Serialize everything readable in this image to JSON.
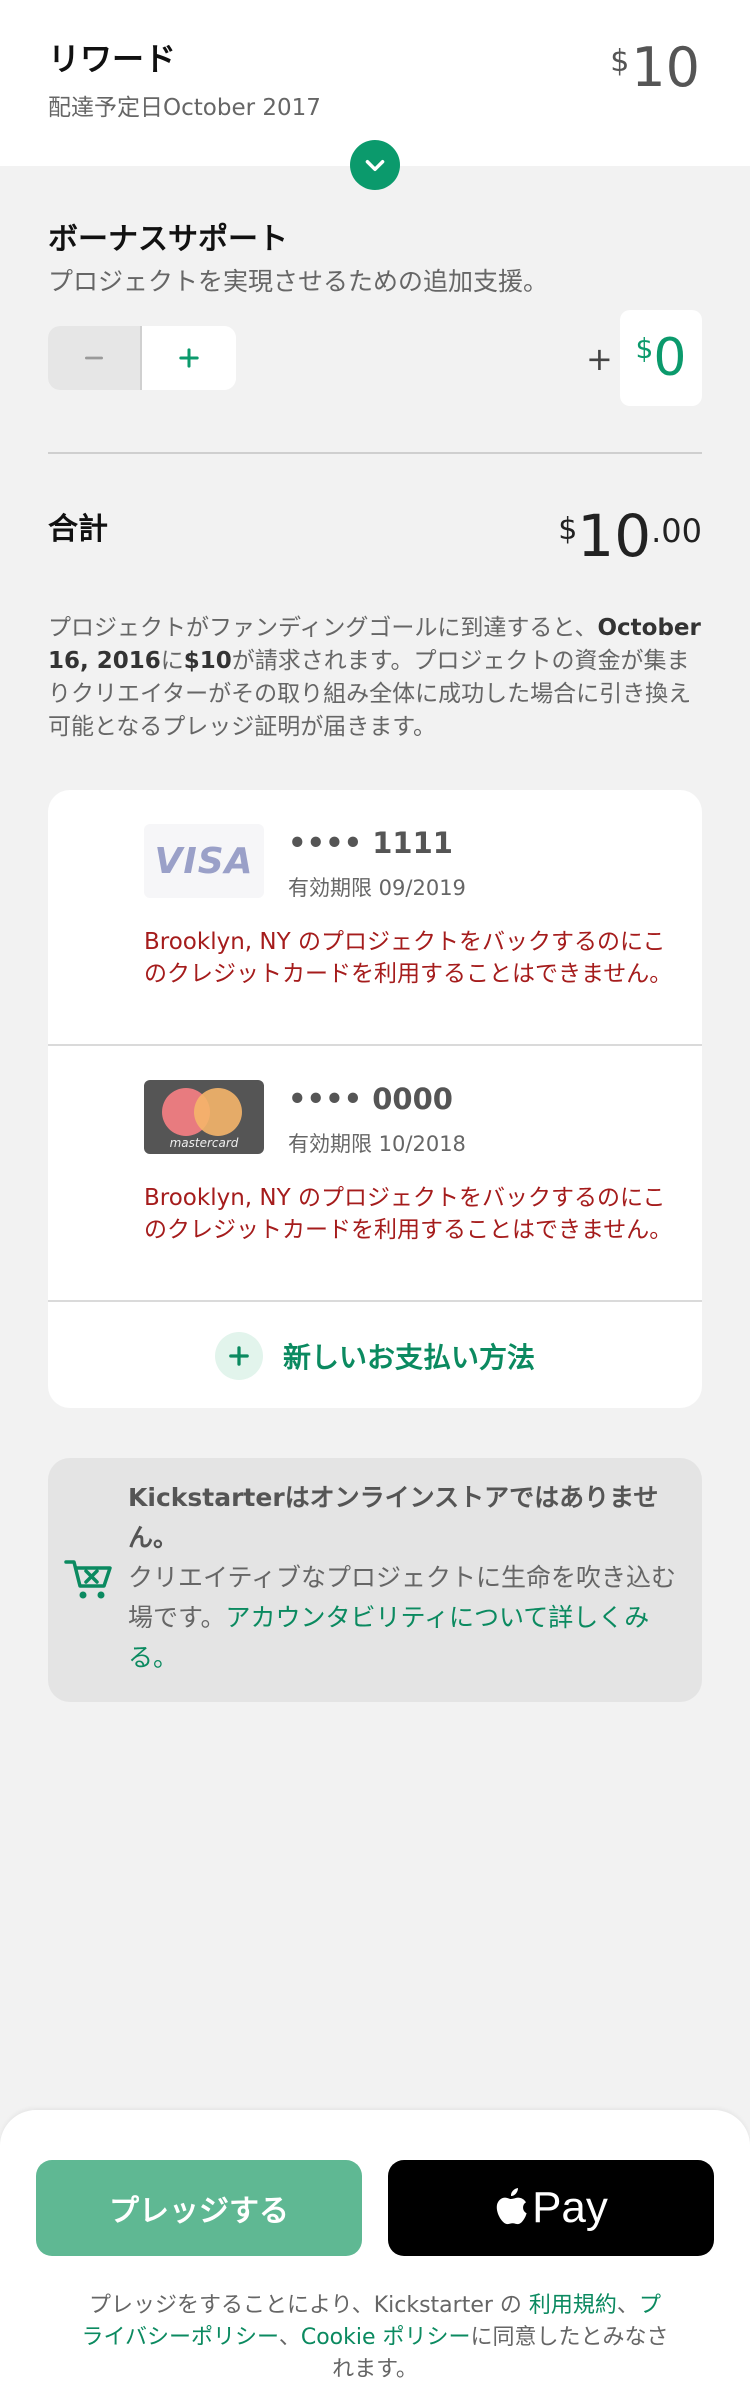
{
  "reward": {
    "title": "リワード",
    "delivery": "配達予定日October 2017",
    "price_currency": "$",
    "price_value": "10"
  },
  "bonus": {
    "title": "ボーナスサポート",
    "description": "プロジェクトを実現させるための追加支援。",
    "plus_sign": "+",
    "amount_currency": "$",
    "amount_value": "0"
  },
  "total": {
    "label": "合計",
    "currency": "$",
    "whole": "10",
    "cents": ".00"
  },
  "notice": {
    "part1": "プロジェクトがファンディングゴールに到達すると、",
    "date": "October 16, 2016",
    "part2": "に",
    "amount": "$10",
    "part3": "が請求されます。プロジェクトの資金が集まりクリエイターがその取り組み全体に成功した場合に引き換え可能となるプレッジ証明が届きます。"
  },
  "cards": [
    {
      "brand": "VISA",
      "number": "•••• 1111",
      "expiry": "有効期限 09/2019",
      "error": "Brooklyn, NY のプロジェクトをバックするのにこのクレジットカードを利用することはできません。"
    },
    {
      "brand": "mastercard",
      "number": "•••• 0000",
      "expiry": "有効期限 10/2018",
      "error": "Brooklyn, NY のプロジェクトをバックするのにこのクレジットカードを利用することはできません。"
    }
  ],
  "add_payment": {
    "label": "新しいお支払い方法"
  },
  "kickstarter_notice": {
    "bold": "Kickstarterはオンラインストアではありません。",
    "text": "クリエイティブなプロジェクトに生命を吹き込む場です。",
    "link": "アカウンタビリティについて詳しくみる。",
    "icon": "cart-x-icon"
  },
  "actions": {
    "pledge_label": "プレッジする",
    "apple_pay_label": "Pay"
  },
  "legal": {
    "prefix": "プレッジをすることにより、Kickstarter の ",
    "terms": "利用規約",
    "sep1": "、",
    "privacy": "プライバシーポリシー",
    "sep2": "、",
    "cookie": "Cookie ポリシー",
    "suffix": "に同意したとみなされます。"
  },
  "colors": {
    "accent": "#0b9a6c",
    "error": "#a51c1c",
    "pledge_button": "#5fb893"
  }
}
